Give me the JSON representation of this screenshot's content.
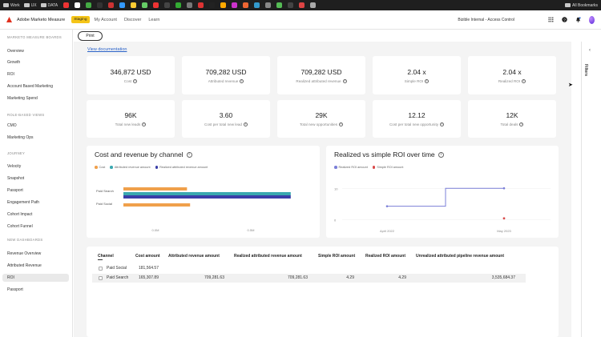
{
  "bookmarks": {
    "items": [
      "Work",
      "UX",
      "DATA"
    ],
    "all_label": "All Bookmarks"
  },
  "header": {
    "app_name": "Adobe Marketo Measure",
    "staging_badge": "Staging",
    "nav": [
      "My Account",
      "Discover",
      "Learn"
    ],
    "org": "Bizible Internal - Access Control"
  },
  "toolbar": {
    "print_label": "Print",
    "view_doc": "View documentation"
  },
  "sidebar": {
    "sections": [
      {
        "title": "MARKETO MEASURE BOARDS",
        "items": [
          "Overview",
          "Growth",
          "ROI",
          "Account Based Marketing",
          "Marketing Spend"
        ]
      },
      {
        "title": "ROLE-BASED VIEWS",
        "items": [
          "CMO",
          "Marketing Ops"
        ]
      },
      {
        "title": "JOURNEY",
        "items": [
          "Velocity",
          "Snapshot",
          "Passport",
          "Engagement Path",
          "Cohort Impact",
          "Cohort Funnel"
        ]
      },
      {
        "title": "NEW DASHBOARDS",
        "items": [
          "Revenue Overview",
          "Attributed Revenue",
          "ROI",
          "Passport"
        ]
      }
    ],
    "active": "ROI"
  },
  "kpis_row1": [
    {
      "value": "346,872 USD",
      "label": "Cost"
    },
    {
      "value": "709,282 USD",
      "label": "Attributed revenue"
    },
    {
      "value": "709,282 USD",
      "label": "Realized attributed revenue"
    },
    {
      "value": "2.04 x",
      "label": "Simple ROI"
    },
    {
      "value": "2.04 x",
      "label": "Realized ROI"
    }
  ],
  "kpis_row2": [
    {
      "value": "96K",
      "label": "Total new leads"
    },
    {
      "value": "3.60",
      "label": "Cost per total new lead"
    },
    {
      "value": "29K",
      "label": "Total new opportunities"
    },
    {
      "value": "12.12",
      "label": "Cost per total new opportunity"
    },
    {
      "value": "12K",
      "label": "Total deals"
    }
  ],
  "charts": {
    "cost_revenue": {
      "title": "Cost and revenue by channel",
      "legend": [
        "Cost",
        "Attributed revenue amount",
        "Realized attributed revenue amount"
      ],
      "colors": [
        "#f0a04b",
        "#3aa8b0",
        "#3a3ea8"
      ]
    },
    "roi_time": {
      "title": "Realized vs simple ROI over time",
      "legend": [
        "Realized ROI amount",
        "Simple ROI amount"
      ],
      "colors": [
        "#7b7fd8",
        "#d94a4a"
      ]
    }
  },
  "chart_data": [
    {
      "type": "bar",
      "title": "Cost and revenue by channel",
      "orientation": "horizontal",
      "categories": [
        "Paid Search",
        "Paid Social"
      ],
      "series": [
        {
          "name": "Cost",
          "values": [
            165307.89,
            181564.57
          ]
        },
        {
          "name": "Attributed revenue amount",
          "values": [
            709281.63,
            0
          ]
        },
        {
          "name": "Realized attributed revenue amount",
          "values": [
            709281.63,
            0
          ]
        }
      ],
      "x_ticks": [
        "0.0M",
        "0.5M"
      ],
      "xlim": [
        0,
        0.72
      ]
    },
    {
      "type": "line",
      "title": "Realized vs simple ROI over time",
      "x_ticks": [
        "April 2022",
        "May 2023"
      ],
      "y_ticks": [
        "10",
        "0"
      ],
      "ylim": [
        -2,
        13
      ],
      "series": [
        {
          "name": "Realized ROI amount",
          "points": [
            [
              0,
              4.29
            ],
            [
              0.5,
              4.29
            ],
            [
              0.5,
              10.1
            ],
            [
              1,
              10.1
            ]
          ]
        },
        {
          "name": "Simple ROI amount",
          "points": [
            [
              1,
              0.4
            ]
          ]
        }
      ]
    }
  ],
  "table": {
    "columns": [
      "Channel",
      "Cost amount",
      "Attributed revenue amount",
      "Realized attributed revenue amount",
      "Simple ROI amount",
      "Realized ROI amount",
      "Unrealized attributed pipeline revenue amount"
    ],
    "rows": [
      {
        "channel": "Paid Social",
        "cost": "181,564.57",
        "attr": "",
        "realized": "",
        "simple_roi": "",
        "realized_roi": "",
        "unrealized": ""
      },
      {
        "channel": "Paid Search",
        "cost": "165,307.89",
        "attr": "709,281.63",
        "realized": "709,281.63",
        "simple_roi": "4.29",
        "realized_roi": "4.29",
        "unrealized": "3,535,684.37"
      }
    ]
  },
  "right_panel": {
    "label": "Filters"
  }
}
